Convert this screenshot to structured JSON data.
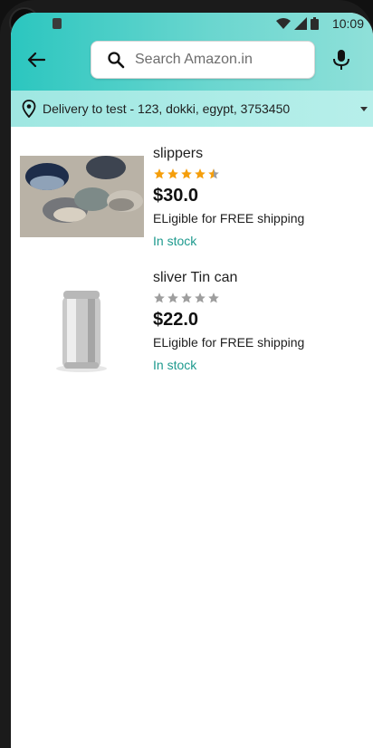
{
  "status_bar": {
    "time": "10:09"
  },
  "header": {
    "search_placeholder": "Search Amazon.in"
  },
  "delivery": {
    "text": "Delivery to test - 123, dokki, egypt, 3753450"
  },
  "products": [
    {
      "title": "slippers",
      "rating": 4.5,
      "price": "$30.0",
      "shipping": "ELigible for FREE shipping",
      "stock": "In stock"
    },
    {
      "title": "sliver Tin can",
      "rating": 0,
      "price": "$22.0",
      "shipping": "ELigible for FREE shipping",
      "stock": "In stock"
    }
  ],
  "colors": {
    "accent": "#2bc6bf",
    "star": "#f59e0b",
    "star_empty": "#9e9e9e",
    "stock": "#1e9a8e"
  },
  "icons": [
    "back-arrow-icon",
    "search-icon",
    "mic-icon",
    "location-pin-icon",
    "dropdown-caret-icon",
    "wifi-icon",
    "signal-icon",
    "battery-icon"
  ]
}
